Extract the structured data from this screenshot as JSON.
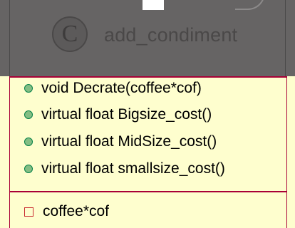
{
  "class": {
    "stereotype_letter": "C",
    "name": "add_condiment"
  },
  "methods": [
    {
      "visibility": "public",
      "text": "void Decrate(coffee*cof)"
    },
    {
      "visibility": "public",
      "text": "virtual float Bigsize_cost()"
    },
    {
      "visibility": "public",
      "text": "virtual float MidSize_cost()"
    },
    {
      "visibility": "public",
      "text": "virtual float smallsize_cost()"
    }
  ],
  "fields": [
    {
      "visibility": "private",
      "text": "coffee*cof"
    }
  ],
  "colors": {
    "background": "#fefece",
    "border": "#a80036",
    "public_marker": "#84be84",
    "private_marker": "#c82930",
    "header_overlay": "#666464"
  }
}
